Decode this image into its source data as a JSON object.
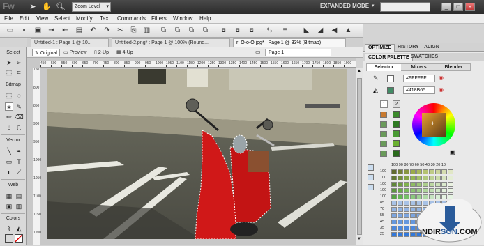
{
  "app": {
    "logo": "Fw",
    "zoom_label": "Zoom Level",
    "mode": "EXPANDED MODE",
    "win_min": "_",
    "win_max": "□",
    "win_close": "×"
  },
  "menu": [
    "File",
    "Edit",
    "View",
    "Select",
    "Modify",
    "Text",
    "Commands",
    "Filters",
    "Window",
    "Help"
  ],
  "toolbar_icons": [
    "new-icon",
    "open-icon",
    "save-icon",
    "import-icon",
    "export-icon",
    "print-icon",
    "undo-icon",
    "redo-icon",
    "cut-icon",
    "copy-icon",
    "paste-icon",
    "group-icon",
    "ungroup-icon",
    "join-icon",
    "split-icon",
    "bring-front-icon",
    "send-back-icon",
    "align-icon",
    "rotate-left-icon",
    "rotate-right-icon",
    "flip-icon",
    "flip-v-icon"
  ],
  "doc_tabs": [
    {
      "label": "Untitled-1 : Page 1 @ 10...",
      "active": false
    },
    {
      "label": "Untitled-2.png* : Page 1 @ 100% (Round...",
      "active": false
    },
    {
      "label": "r_O-o-O.jpg* : Page 1 @ 33% (Bitmap)",
      "active": true
    }
  ],
  "view": {
    "original": "Original",
    "preview": "Preview",
    "two_up": "2-Up",
    "four_up": "4-Up",
    "page": "Page 1"
  },
  "tools": {
    "select": "Select",
    "bitmap": "Bitmap",
    "vector": "Vector",
    "web": "Web",
    "colors": "Colors"
  },
  "ruler_h": [
    "450",
    "500",
    "550",
    "600",
    "650",
    "700",
    "750",
    "800",
    "850",
    "900",
    "950",
    "1000",
    "1050",
    "1100",
    "1150",
    "1200",
    "1250",
    "1300",
    "1350",
    "1400",
    "1450",
    "1500",
    "1550",
    "1600",
    "1650",
    "1700",
    "1750",
    "1800",
    "1850",
    "1900"
  ],
  "ruler_v": [
    "750",
    "800",
    "850",
    "900",
    "950",
    "1000",
    "1050",
    "1100",
    "1150",
    "1200"
  ],
  "panels": {
    "top_tabs": [
      "OPTIMIZE",
      "HISTORY",
      "ALIGN"
    ],
    "color_tabs": [
      "COLOR PALETTE",
      "SWATCHES"
    ],
    "sub_tabs": [
      "Selector",
      "Mixers",
      "Blender"
    ],
    "stroke_hex": "#FFFFFF",
    "fill_hex": "#418B65",
    "swatch_nums": [
      "1",
      "2"
    ],
    "grid_header": "100 90 80 70 60 50 40 30 20 10",
    "grid_rows": [
      "100",
      "100",
      "100",
      "100",
      "100",
      "85",
      "70",
      "55",
      "45",
      "35",
      "25"
    ]
  },
  "watermark": {
    "text_a": "iNDIR",
    "text_b": "SON",
    "text_c": ".COM"
  },
  "colors": {
    "accent": "#2a5b9a",
    "swatch_green": "#3c8a2c",
    "fill": "#418B65",
    "scooter_red": "#d01818"
  }
}
